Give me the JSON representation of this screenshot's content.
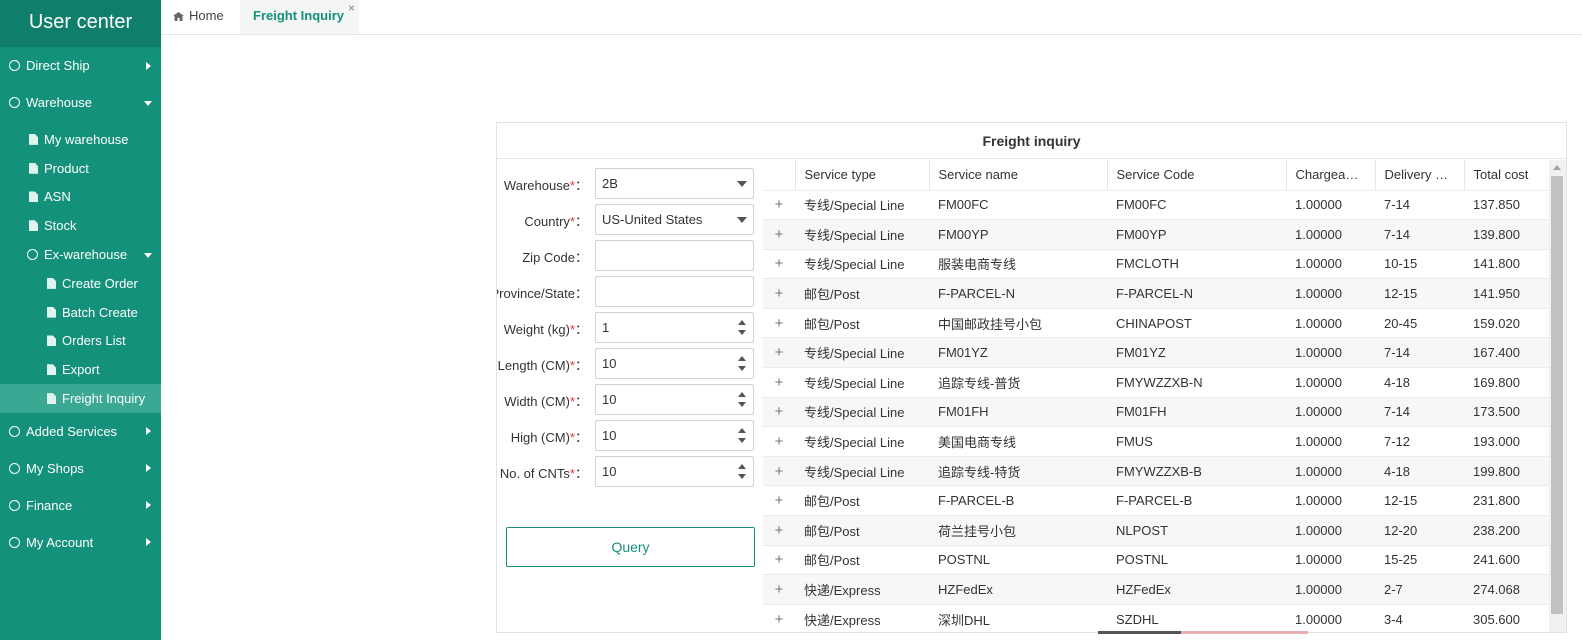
{
  "sidebar": {
    "title": "User center",
    "items": {
      "direct_ship": "Direct Ship",
      "warehouse": "Warehouse",
      "my_warehouse": "My warehouse",
      "product": "Product",
      "asn": "ASN",
      "stock": "Stock",
      "ex_warehouse": "Ex-warehouse",
      "create_order": "Create Order",
      "batch_create": "Batch Create",
      "orders_list": "Orders List",
      "export": "Export",
      "freight_inquiry": "Freight Inquiry",
      "added_services": "Added Services",
      "my_shops": "My Shops",
      "finance": "Finance",
      "my_account": "My Account"
    }
  },
  "tabs": {
    "home": "Home",
    "freight": "Freight Inquiry",
    "close": "×"
  },
  "panel": {
    "title": "Freight inquiry"
  },
  "form": {
    "warehouse": {
      "label": "Warehouse",
      "value": "2B"
    },
    "country": {
      "label": "Country",
      "value": "US-United States"
    },
    "zip": {
      "label": "Zip Code",
      "value": ""
    },
    "province": {
      "label": "Province/State",
      "value": ""
    },
    "weight": {
      "label": "Weight (kg)",
      "value": "1"
    },
    "length": {
      "label": "Length (CM)",
      "value": "10"
    },
    "width": {
      "label": "Width (CM)",
      "value": "10"
    },
    "high": {
      "label": "High (CM)",
      "value": "10"
    },
    "cnts": {
      "label": "No. of CNTs",
      "value": "10"
    },
    "required_mark": "*",
    "colon": "：",
    "query_label": "Query"
  },
  "table": {
    "headers": [
      "Service type",
      "Service name",
      "Service Code",
      "Chargeabl…",
      "Delivery d…",
      "Total cost"
    ],
    "expand_symbol": "+",
    "rows": [
      [
        "专线/Special Line",
        "FM00FC",
        "FM00FC",
        "1.00000",
        "7-14",
        "137.850"
      ],
      [
        "专线/Special Line",
        "FM00YP",
        "FM00YP",
        "1.00000",
        "7-14",
        "139.800"
      ],
      [
        "专线/Special Line",
        "服装电商专线",
        "FMCLOTH",
        "1.00000",
        "10-15",
        "141.800"
      ],
      [
        "邮包/Post",
        "F-PARCEL-N",
        "F-PARCEL-N",
        "1.00000",
        "12-15",
        "141.950"
      ],
      [
        "邮包/Post",
        "中国邮政挂号小包",
        "CHINAPOST",
        "1.00000",
        "20-45",
        "159.020"
      ],
      [
        "专线/Special Line",
        "FM01YZ",
        "FM01YZ",
        "1.00000",
        "7-14",
        "167.400"
      ],
      [
        "专线/Special Line",
        "追踪专线-普货",
        "FMYWZZXB-N",
        "1.00000",
        "4-18",
        "169.800"
      ],
      [
        "专线/Special Line",
        "FM01FH",
        "FM01FH",
        "1.00000",
        "7-14",
        "173.500"
      ],
      [
        "专线/Special Line",
        "美国电商专线",
        "FMUS",
        "1.00000",
        "7-12",
        "193.000"
      ],
      [
        "专线/Special Line",
        "追踪专线-特货",
        "FMYWZZXB-B",
        "1.00000",
        "4-18",
        "199.800"
      ],
      [
        "邮包/Post",
        "F-PARCEL-B",
        "F-PARCEL-B",
        "1.00000",
        "12-15",
        "231.800"
      ],
      [
        "邮包/Post",
        "荷兰挂号小包",
        "NLPOST",
        "1.00000",
        "12-20",
        "238.200"
      ],
      [
        "邮包/Post",
        "POSTNL",
        "POSTNL",
        "1.00000",
        "15-25",
        "241.600"
      ],
      [
        "快递/Express",
        "HZFedEx",
        "HZFedEx",
        "1.00000",
        "2-7",
        "274.068"
      ],
      [
        "快递/Express",
        "深圳DHL",
        "SZDHL",
        "1.00000",
        "3-4",
        "305.600"
      ]
    ]
  },
  "colors": {
    "brand": "#14917a",
    "active_item": "#3aa893",
    "required": "#e0353b"
  }
}
